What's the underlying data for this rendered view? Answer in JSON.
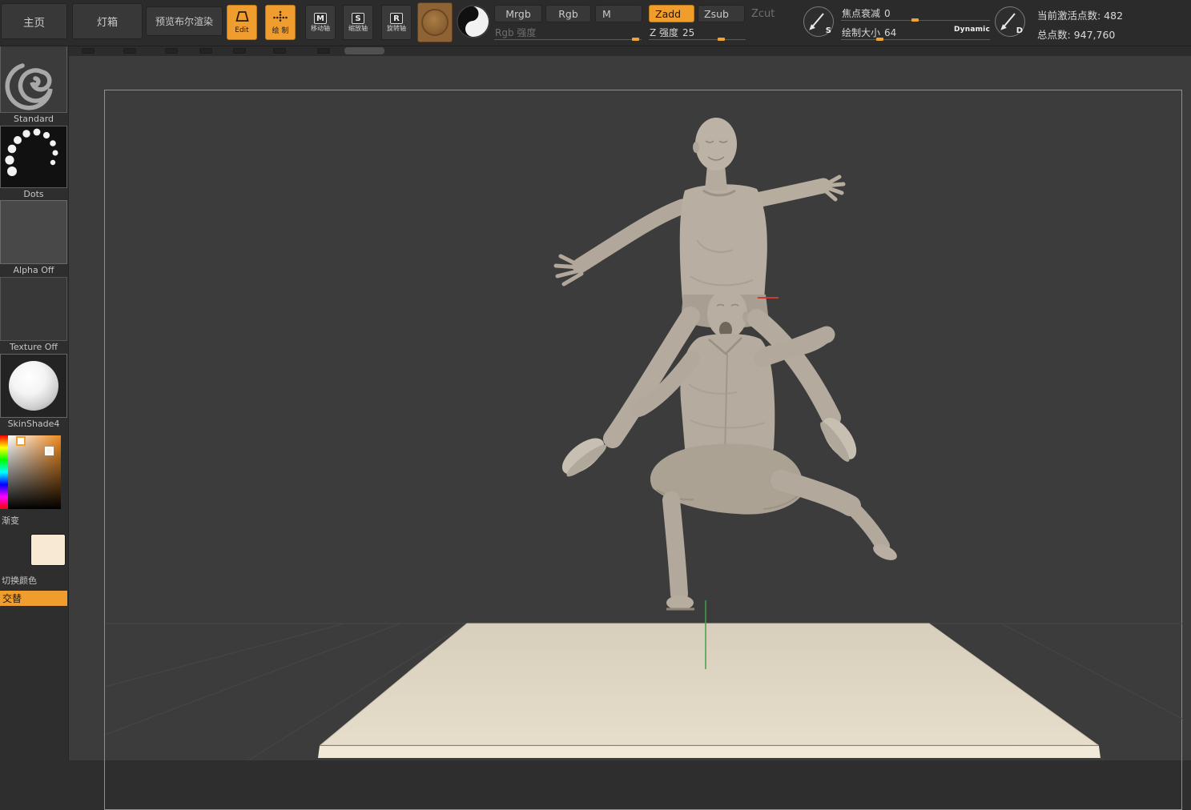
{
  "toolbar": {
    "home": "主页",
    "lightbox": "灯箱",
    "preview": "预览布尔渲染",
    "edit_label": "Edit",
    "draw_label": "绘 制",
    "move_key": "M",
    "move_label": "移动轴",
    "scale_key": "S",
    "scale_label": "缩放轴",
    "rotate_key": "R",
    "rotate_label": "旋转轴",
    "mrgb": "Mrgb",
    "rgb": "Rgb",
    "m": "M",
    "zadd": "Zadd",
    "zsub": "Zsub",
    "zcut": "Zcut",
    "rgb_intensity_label": "Rgb 强度",
    "z_intensity_label": "Z 强度",
    "z_intensity_value": "25",
    "focal_label": "焦点衰减",
    "focal_value": "0",
    "size_label": "绘制大小",
    "size_value": "64",
    "dynamic_label": "Dynamic",
    "brush_s": "S",
    "brush_d": "D",
    "active_points": "当前激活点数: 482",
    "total_points": "总点数: 947,760"
  },
  "sidebar": {
    "brush": "Standard",
    "stroke": "Dots",
    "alpha": "Alpha Off",
    "texture": "Texture Off",
    "material": "SkinShade4",
    "gradient": "渐变",
    "switch_color": "切换颜色",
    "alternate": "交替"
  },
  "colors": {
    "accent_orange": "#ef9d2e",
    "clay": "#b4ab9e",
    "platform_top": "#ded4c2",
    "platform_front": "#f1ead9",
    "axis_green": "#43a047",
    "axis_red": "#cf3a2e",
    "canvas_bg": "#3c3c3c"
  }
}
